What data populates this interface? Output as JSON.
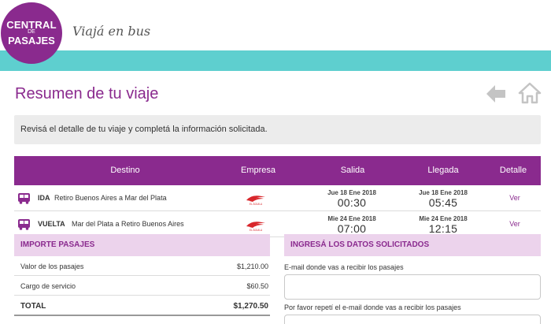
{
  "header": {
    "logo": {
      "line1": "CENTRAL",
      "line2": "DE",
      "line3": "PASAJES"
    },
    "tagline": "Viajá en bus",
    "accent": "#8a2a8e",
    "bar_color": "#5ecfcf"
  },
  "page": {
    "title": "Resumen de tu viaje",
    "notice": "Revisá el detalle de tu viaje y completá la información solicitada."
  },
  "nav": {
    "back_icon": "arrow-left-icon",
    "home_icon": "home-icon"
  },
  "trips": {
    "columns": [
      "Destino",
      "Empresa",
      "Salida",
      "Llegada",
      "Detalle"
    ],
    "rows": [
      {
        "direction": "IDA",
        "route": "Retiro Buenos Aires a Mar del Plata",
        "company": "EL ÁGUILA",
        "departure_date": "Jue 18 Ene 2018",
        "departure_time": "00:30",
        "arrival_date": "Jue 18 Ene 2018",
        "arrival_time": "05:45",
        "detail": "Ver"
      },
      {
        "direction": "VUELTA",
        "route": "Mar del Plata a Retiro Buenos Aires",
        "company": "EL ÁGUILA",
        "departure_date": "Mie 24 Ene 2018",
        "departure_time": "07:00",
        "arrival_date": "Mie 24 Ene 2018",
        "arrival_time": "12:15",
        "detail": "Ver"
      }
    ]
  },
  "pricing": {
    "title": "IMPORTE PASAJES",
    "items": [
      {
        "label": "Valor de los pasajes",
        "value": "$1,210.00"
      },
      {
        "label": "Cargo de servicio",
        "value": "$60.50"
      }
    ],
    "total_label": "TOTAL",
    "total_value": "$1,270.50"
  },
  "form": {
    "title": "INGRESÁ LOS DATOS SOLICITADOS",
    "email_label": "E-mail donde vas a recibir los pasajes",
    "email_value": "",
    "confirm_label": "Por favor repetí el e-mail donde vas a recibir los pasajes",
    "confirm_value": ""
  }
}
